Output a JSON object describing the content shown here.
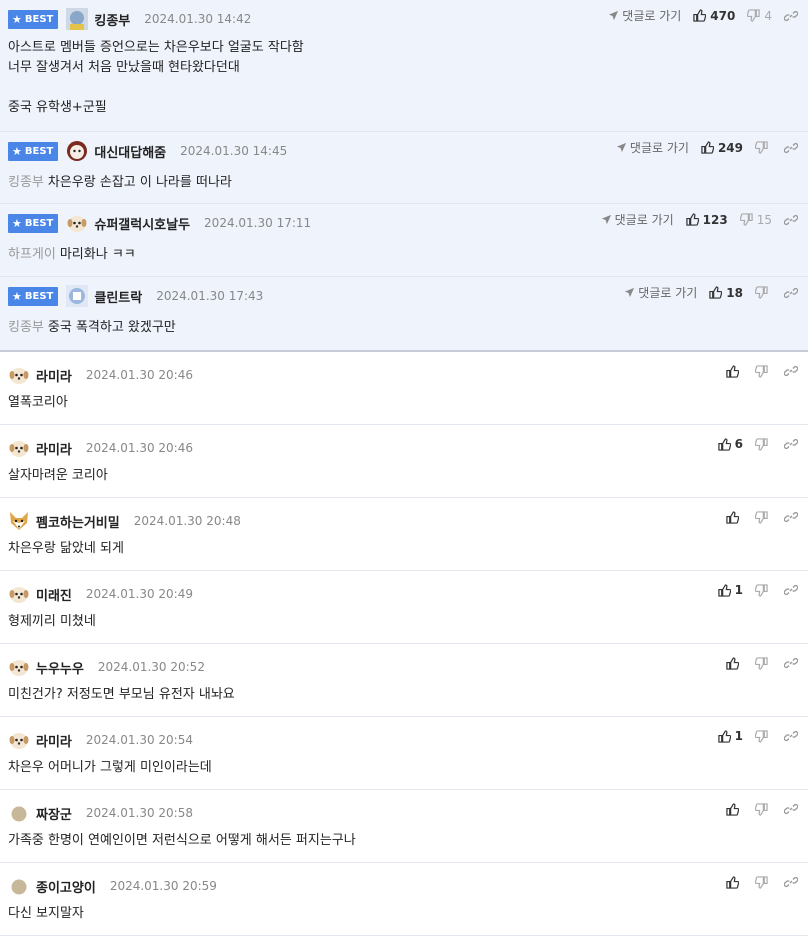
{
  "best_comments": [
    {
      "nick": "킹종부",
      "date": "2024.01.30 14:42",
      "reply_to": "",
      "text": "아스트로 멤버들 증언으로는 차은우보다 얼굴도 작다함\n너무 잘생겨서 처음 만났을때 현타왔다던대\n\n중국 유학생+군필",
      "up": "470",
      "down": "4",
      "reply_label": "댓글로 가기",
      "badge": "BEST"
    },
    {
      "nick": "대신대답해줌",
      "date": "2024.01.30 14:45",
      "reply_to": "킹종부",
      "text": "차은우랑 손잡고 이 나라를 떠나라",
      "up": "249",
      "down": "",
      "reply_label": "댓글로 가기",
      "badge": "BEST"
    },
    {
      "nick": "슈퍼갤럭시호날두",
      "date": "2024.01.30 17:11",
      "reply_to": "하프게이",
      "text": "마리화나 ㅋㅋ",
      "up": "123",
      "down": "15",
      "reply_label": "댓글로 가기",
      "badge": "BEST"
    },
    {
      "nick": "클린트락",
      "date": "2024.01.30 17:43",
      "reply_to": "킹종부",
      "text": "중국 폭격하고 왔겠구만",
      "up": "18",
      "down": "",
      "reply_label": "댓글로 가기",
      "badge": "BEST"
    }
  ],
  "comments": [
    {
      "nick": "라미라",
      "date": "2024.01.30 20:46",
      "text": "열폭코리아",
      "up": ""
    },
    {
      "nick": "라미라",
      "date": "2024.01.30 20:46",
      "text": "살자마려운 코리아",
      "up": "6"
    },
    {
      "nick": "펨코하는거비밀",
      "date": "2024.01.30 20:48",
      "text": "차은우랑 닮았네 되게",
      "up": ""
    },
    {
      "nick": "미래진",
      "date": "2024.01.30 20:49",
      "text": "형제끼리 미쳤네",
      "up": "1"
    },
    {
      "nick": "누우누우",
      "date": "2024.01.30 20:52",
      "text": "미친건가? 저정도면 부모님 유전자 내놔요",
      "up": ""
    },
    {
      "nick": "라미라",
      "date": "2024.01.30 20:54",
      "text": "차은우 어머니가 그렇게 미인이라는데",
      "up": "1"
    },
    {
      "nick": "짜장군",
      "date": "2024.01.30 20:58",
      "text": "가족중 한명이 연예인이면 저런식으로 어떻게 해서든 퍼지는구나",
      "up": ""
    },
    {
      "nick": "종이고양이",
      "date": "2024.01.30 20:59",
      "text": "다신 보지말자",
      "up": ""
    }
  ],
  "icons": {
    "badge_star": "star-icon",
    "reply": "arrow-icon",
    "upvote": "thumbs-up-icon",
    "downvote": "thumbs-down-icon",
    "link": "link-icon"
  },
  "colors": {
    "best_bg": "#eff3fc",
    "badge": "#4a86e8",
    "date": "#888888"
  }
}
